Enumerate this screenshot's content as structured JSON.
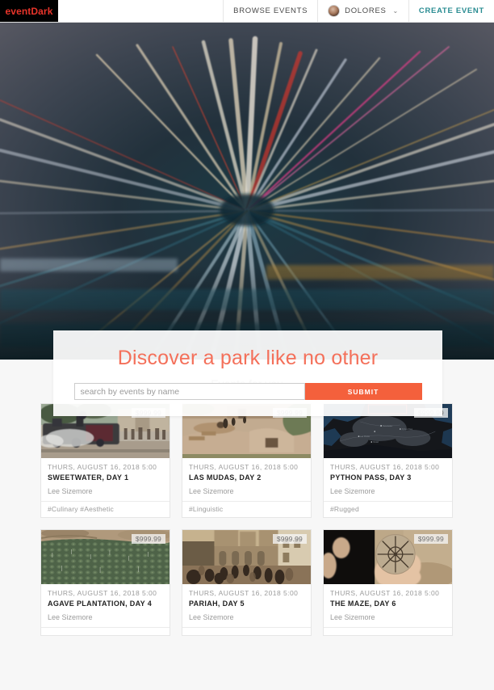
{
  "navbar": {
    "brand": "eventDark",
    "browse_label": "BROWSE EVENTS",
    "user_name": "DOLORES",
    "caret": "⌄",
    "create_label": "CREATE EVENT",
    "accent_create": "#2a8c92",
    "brand_color": "#e8342a"
  },
  "hero": {
    "title": "Discover a park like no other",
    "title_color": "#f4705a",
    "search_placeholder": "search by events by name",
    "search_value": "",
    "submit_label": "SUBMIT",
    "submit_color": "#f4603c"
  },
  "events": {
    "heading": "Events for you",
    "cards": [
      {
        "price": "$999.99",
        "date": "THURS, AUGUST 16, 2018 5:00",
        "title": "SWEETWATER, DAY 1",
        "author": "Lee Sizemore",
        "tags": "#Culinary #Aesthetic",
        "image_name": "steam-train-town"
      },
      {
        "price": "$999.99",
        "date": "THURS, AUGUST 16, 2018 5:00",
        "title": "LAS MUDAS, DAY 2",
        "author": "Lee Sizemore",
        "tags": "#Linguistic",
        "image_name": "adobe-village"
      },
      {
        "price": "$999.99",
        "date": "THURS, AUGUST 16, 2018 5:00",
        "title": "PYTHON PASS, DAY 3",
        "author": "Lee Sizemore",
        "tags": "#Rugged",
        "image_name": "dark-map"
      },
      {
        "price": "$999.99",
        "date": "THURS, AUGUST 16, 2018 5:00",
        "title": "AGAVE PLANTATION, DAY 4",
        "author": "Lee Sizemore",
        "tags": "",
        "image_name": "agave-field"
      },
      {
        "price": "$999.99",
        "date": "THURS, AUGUST 16, 2018 5:00",
        "title": "PARIAH, DAY 5",
        "author": "Lee Sizemore",
        "tags": "",
        "image_name": "crowded-street"
      },
      {
        "price": "$999.99",
        "date": "THURS, AUGUST 16, 2018 5:00",
        "title": "THE MAZE, DAY 6",
        "author": "Lee Sizemore",
        "tags": "",
        "image_name": "maze-stone"
      }
    ]
  }
}
